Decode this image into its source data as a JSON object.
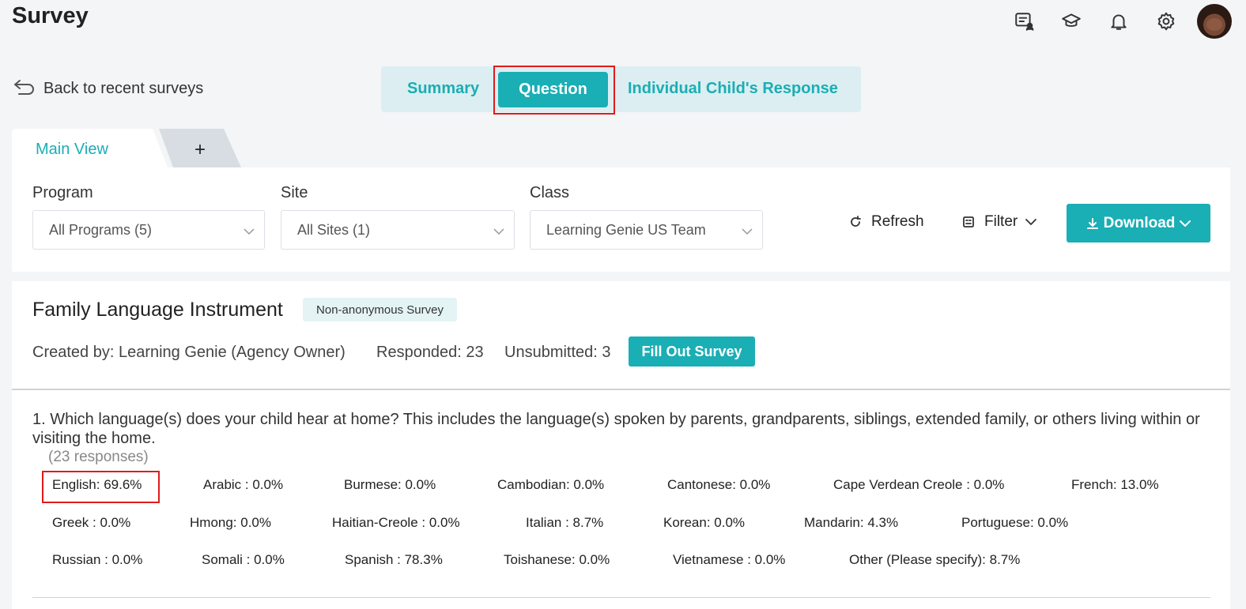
{
  "header": {
    "title": "Survey",
    "icons": [
      "message-user-icon",
      "graduation-cap-icon",
      "bell-icon",
      "gear-icon",
      "avatar"
    ]
  },
  "back_link": {
    "label": "Back to recent surveys"
  },
  "view_tabs": {
    "summary": "Summary",
    "question": "Question",
    "individual": "Individual Child's Response",
    "active": "Question"
  },
  "sheet_tabs": {
    "main": "Main View",
    "add": "+"
  },
  "filters": {
    "program": {
      "label": "Program",
      "value": "All Programs (5)"
    },
    "site": {
      "label": "Site",
      "value": "All Sites (1)"
    },
    "class": {
      "label": "Class",
      "value": "Learning Genie US Team"
    },
    "refresh_label": "Refresh",
    "filter_label": "Filter",
    "download_label": "Download"
  },
  "survey": {
    "title": "Family Language Instrument",
    "badge": "Non-anonymous Survey",
    "created_by": "Created by: Learning Genie (Agency Owner)",
    "responded": "Responded: 23",
    "unsubmitted": "Unsubmitted: 3",
    "fill_out_label": "Fill Out Survey"
  },
  "question": {
    "text": "1. Which language(s) does your child hear at home? This includes the language(s) spoken by parents, grandparents, siblings, extended family, or others living within or visiting the home.",
    "responses": "(23 responses)",
    "options": [
      "English: 69.6%",
      "Arabic : 0.0%",
      "Burmese: 0.0%",
      "Cambodian: 0.0%",
      "Cantonese: 0.0%",
      "Cape Verdean Creole : 0.0%",
      "French: 13.0%",
      "Greek : 0.0%",
      "Hmong: 0.0%",
      "Haitian-Creole : 0.0%",
      "Italian : 8.7%",
      "Korean: 0.0%",
      "Mandarin: 4.3%",
      "Portuguese: 0.0%",
      "Russian : 0.0%",
      "Somali : 0.0%",
      "Spanish : 78.3%",
      "Toishanese: 0.0%",
      "Vietnamese : 0.0%",
      "Other (Please specify): 8.7%"
    ]
  },
  "colors": {
    "accent": "#1aaeb5",
    "highlight": "#e01b1b"
  }
}
